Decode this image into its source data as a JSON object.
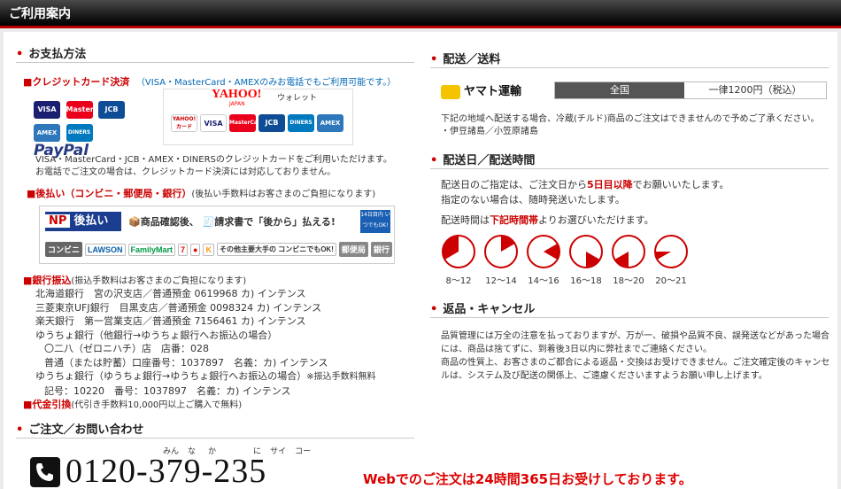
{
  "header_title": "ご利用案内",
  "payment": {
    "title": "お支払方法",
    "credit_title": "■クレジットカード決済",
    "credit_note": "（VISA・MasterCard・AMEXのみお電話でもご利用可能です。）",
    "cards_left": [
      "VISA",
      "MasterCard",
      "JCB",
      "AMEX",
      "DINERS",
      "PayPal"
    ],
    "yahoo_logo": "YAHOO!",
    "yahoo_japan": "JAPAN",
    "yahoo_wallet": "ウォレット",
    "cards_right": [
      "YAHOO! カード",
      "VISA",
      "MasterCard",
      "JCB",
      "DINERS",
      "AMEX"
    ],
    "credit_desc1": "VISA・MasterCard・JCB・AMEX・DINERSのクレジットカードをご利用いただけます。",
    "credit_desc2": "お電話でご注文の場合は、クレジットカード決済には対応しておりません。",
    "postpay_title": "■後払い（コンビニ・郵便局・銀行）",
    "postpay_note": "(後払い手数料はお客さまのご負担になります)",
    "postpay_banner": {
      "brand": "NP",
      "label": "後払い",
      "text1": "商品確認後、",
      "text2": "請求書で「後から」払える!",
      "badge": "14日目内 いつでもOK!",
      "konbini": "コンビニ",
      "lawson": "LAWSON",
      "familymart": "FamilyMart",
      "other": "その他主要大手の コンビニでもOK!",
      "post": "郵便局",
      "bank": "銀行"
    },
    "bank_title": "■銀行振込",
    "bank_note": "(振込手数料はお客さまのご負担になります)",
    "bank_lines": [
      "北海道銀行　宮の沢支店／普通預金 0619968 カ) インテンス",
      "三菱東京UFJ銀行　目黒支店／普通預金 0098324 カ) インテンス",
      "楽天銀行　第一営業支店／普通預金 7156461 カ) インテンス",
      "ゆうちょ銀行（他銀行→ゆうちょ銀行へお振込の場合）",
      "〇二八（ゼロニハチ）店　店番：028",
      "普通（または貯蓄）口座番号：1037897　名義：カ) インテンス",
      "ゆうちょ銀行（ゆうちょ銀行→ゆうちょ銀行へお振込の場合）",
      "記号：10220　番号：1037897　名義：カ) インテンス"
    ],
    "bank_fee_note": "※振込手数料無料",
    "cod_title": "■代金引換",
    "cod_note": "(代引き手数料10,000円以上ご購入で無料)"
  },
  "contact": {
    "title": "ご注文／お問い合わせ",
    "ruby": [
      "みん",
      "な",
      "か",
      "に",
      "サイ",
      "コー"
    ],
    "phone": "0120-379-235",
    "web_note": "Webでのご注文は24時間365日お受けしております。"
  },
  "shipping": {
    "title": "配送／送料",
    "carrier": "ヤマト運輸",
    "region": "全国",
    "fee": "一律1200円（税込）",
    "note1": "下記の地域へ配送する場合、冷蔵(チルド)商品のご注文はできませんので予めご了承ください。",
    "note2": "・伊豆諸島／小笠原諸島"
  },
  "delivery": {
    "title": "配送日／配送時間",
    "line1a": "配送日のご指定は、ご注文日から",
    "line1b": "5日目以降",
    "line1c": "でお願いいたします。",
    "line2": "指定のない場合は、随時発送いたします。",
    "line3a": "配送時間は",
    "line3b": "下記時間帯",
    "line3c": "よりお選びいただけます。",
    "slots": [
      {
        "label": "8～12",
        "start": 8,
        "end": 12
      },
      {
        "label": "12～14",
        "start": 12,
        "end": 14
      },
      {
        "label": "14～16",
        "start": 14,
        "end": 16
      },
      {
        "label": "16～18",
        "start": 16,
        "end": 18
      },
      {
        "label": "18～20",
        "start": 18,
        "end": 20
      },
      {
        "label": "20～21",
        "start": 20,
        "end": 21
      }
    ]
  },
  "returns": {
    "title": "返品・キャンセル",
    "p1": "品質管理には万全の注意を払っておりますが、万が一、破損や品質不良、誤発送などがあった場合には、商品は捨てずに、到着後3日以内に弊社までご連絡ください。",
    "p2": "商品の性質上、お客さまのご都合による返品・交換はお受けできません。ご注文確定後のキャンセルは、システム及び配送の関係上、ご遠慮くださいますようお願い申し上げます。"
  },
  "colors": {
    "accent": "#cc0000",
    "header_bg": "#1a1a1a"
  }
}
